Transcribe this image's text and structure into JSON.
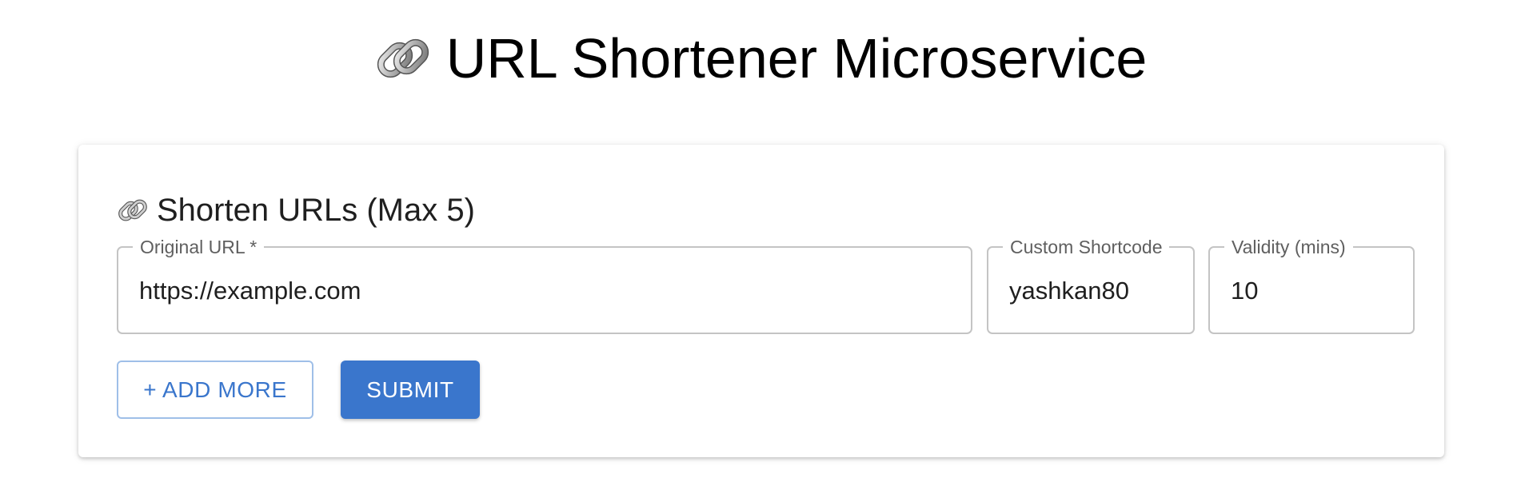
{
  "header": {
    "title": "URL Shortener Microservice",
    "icon": "link-icon"
  },
  "form": {
    "title": "Shorten URLs (Max 5)",
    "icon": "link-icon",
    "fields": {
      "original_url": {
        "label": "Original URL *",
        "value": "https://example.com"
      },
      "custom_shortcode": {
        "label": "Custom Shortcode",
        "value": "yashkan80"
      },
      "validity": {
        "label": "Validity (mins)",
        "value": "10"
      }
    },
    "buttons": {
      "add_more": "+ ADD MORE",
      "submit": "SUBMIT"
    }
  },
  "colors": {
    "accent": "#3a76cc",
    "outline_border": "#9fbfe8",
    "field_border": "#c4c4c4"
  }
}
